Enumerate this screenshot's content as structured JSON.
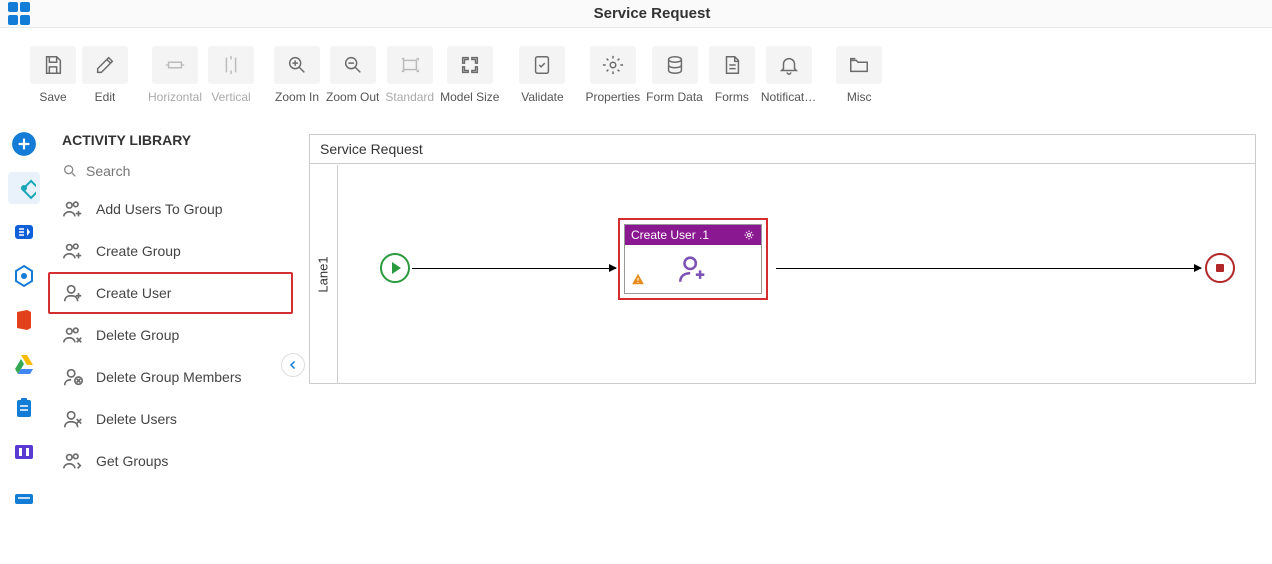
{
  "header": {
    "title": "Service Request"
  },
  "toolbar": {
    "save": "Save",
    "edit": "Edit",
    "horizontal": "Horizontal",
    "vertical": "Vertical",
    "zoom_in": "Zoom In",
    "zoom_out": "Zoom Out",
    "standard": "Standard",
    "model_size": "Model Size",
    "validate": "Validate",
    "properties": "Properties",
    "form_data": "Form Data",
    "forms": "Forms",
    "notifications": "Notificat…",
    "misc": "Misc"
  },
  "sidebar": {
    "heading": "ACTIVITY LIBRARY",
    "search_placeholder": "Search",
    "items": [
      {
        "label": "Add Users To Group"
      },
      {
        "label": "Create Group"
      },
      {
        "label": "Create User",
        "selected": true
      },
      {
        "label": "Delete Group"
      },
      {
        "label": "Delete Group Members"
      },
      {
        "label": "Delete Users"
      },
      {
        "label": "Get Groups"
      }
    ]
  },
  "canvas": {
    "title": "Service Request",
    "lane_label": "Lane1",
    "activity_label": "Create User .1"
  },
  "rail_colors": {
    "exchange": "#0e5fd8",
    "hex": "#137cd7",
    "office": "#e3411b",
    "drive_green": "#34a853",
    "drive_yellow": "#fbbc05",
    "drive_blue": "#4285f4",
    "purple": "#5a3bd1"
  }
}
